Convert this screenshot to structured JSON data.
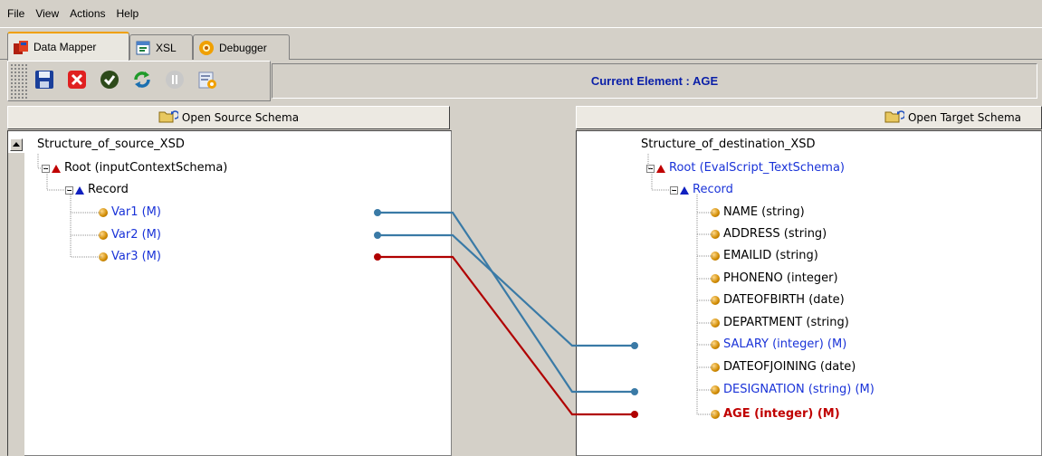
{
  "menu": [
    "File",
    "View",
    "Actions",
    "Help"
  ],
  "tabs": [
    {
      "label": "Data Mapper",
      "icon": "data-mapper-icon"
    },
    {
      "label": "XSL",
      "icon": "xsl-icon"
    },
    {
      "label": "Debugger",
      "icon": "debugger-icon"
    }
  ],
  "toolbar": {
    "buttons": [
      "save-icon",
      "close-icon",
      "check-icon",
      "refresh-icon",
      "pause-icon",
      "settings-icon"
    ]
  },
  "current_element": "Current Element : AGE",
  "source": {
    "open_label": "Open Source Schema",
    "root_label": "Structure_of_source_XSD",
    "root_node": "Root (inputContextSchema)",
    "record": "Record",
    "fields": [
      "Var1  (M)",
      "Var2  (M)",
      "Var3  (M)"
    ]
  },
  "target": {
    "open_label": "Open Target Schema",
    "root_label": "Structure_of_destination_XSD",
    "root_node": "Root (EvalScript_TextSchema)",
    "record": "Record",
    "fields": [
      "NAME  (string)",
      "ADDRESS  (string)",
      "EMAILID  (string)",
      "PHONENO  (integer)",
      "DATEOFBIRTH  (date)",
      "DEPARTMENT  (string)",
      "SALARY  (integer)  (M)",
      "DATEOFJOINING  (date)",
      "DESIGNATION  (string)  (M)",
      "AGE  (integer)  (M)"
    ]
  },
  "colors": {
    "link_blue": "#3a7aa6",
    "link_red": "#b00000"
  }
}
